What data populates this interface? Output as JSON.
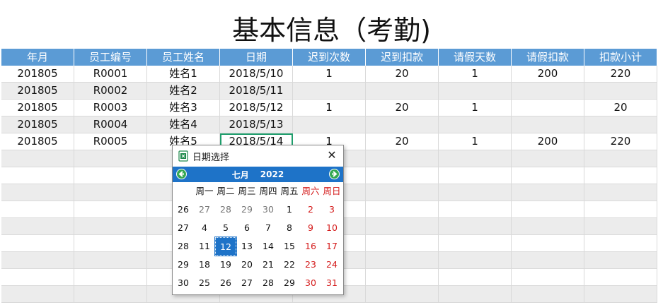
{
  "sheet": {
    "title": "基本信息（考勤)",
    "headers": [
      "年月",
      "员工编号",
      "员工姓名",
      "日期",
      "迟到次数",
      "迟到扣款",
      "请假天数",
      "请假扣款",
      "扣款小计"
    ],
    "rows": [
      [
        "201805",
        "R0001",
        "姓名1",
        "2018/5/10",
        "1",
        "20",
        "1",
        "200",
        "220"
      ],
      [
        "201805",
        "R0002",
        "姓名2",
        "2018/5/11",
        "",
        "",
        "",
        "",
        ""
      ],
      [
        "201805",
        "R0003",
        "姓名3",
        "2018/5/12",
        "1",
        "20",
        "1",
        "",
        "20"
      ],
      [
        "201805",
        "R0004",
        "姓名4",
        "2018/5/13",
        "",
        "",
        "",
        "",
        ""
      ],
      [
        "201805",
        "R0005",
        "姓名5",
        "2018/5/14",
        "1",
        "20",
        "1",
        "200",
        "220"
      ],
      [
        "",
        "",
        "",
        "",
        "",
        "",
        "",
        "",
        ""
      ],
      [
        "",
        "",
        "",
        "",
        "",
        "",
        "",
        "",
        ""
      ],
      [
        "",
        "",
        "",
        "",
        "",
        "",
        "",
        "",
        ""
      ],
      [
        "",
        "",
        "",
        "",
        "",
        "",
        "",
        "",
        ""
      ],
      [
        "",
        "",
        "",
        "",
        "",
        "",
        "",
        "",
        ""
      ],
      [
        "",
        "",
        "",
        "",
        "",
        "",
        "",
        "",
        ""
      ],
      [
        "",
        "",
        "",
        "",
        "",
        "",
        "",
        "",
        ""
      ],
      [
        "",
        "",
        "",
        "",
        "",
        "",
        "",
        "",
        ""
      ],
      [
        "",
        "",
        "",
        "",
        "",
        "",
        "",
        "",
        ""
      ]
    ]
  },
  "picker": {
    "title": "日期选择",
    "close_icon": "close-icon",
    "month": "七月",
    "year": "2022",
    "weekdays": [
      "周一",
      "周二",
      "周三",
      "周四",
      "周五",
      "周六",
      "周日"
    ],
    "weeks": [
      {
        "num": "26",
        "days": [
          "27",
          "28",
          "29",
          "30",
          "1",
          "2",
          "3"
        ]
      },
      {
        "num": "27",
        "days": [
          "4",
          "5",
          "6",
          "7",
          "8",
          "9",
          "10"
        ]
      },
      {
        "num": "28",
        "days": [
          "11",
          "12",
          "13",
          "14",
          "15",
          "16",
          "17"
        ]
      },
      {
        "num": "29",
        "days": [
          "18",
          "19",
          "20",
          "21",
          "22",
          "23",
          "24"
        ]
      },
      {
        "num": "30",
        "days": [
          "25",
          "26",
          "27",
          "28",
          "29",
          "30",
          "31"
        ]
      }
    ],
    "selected_day": "12",
    "colors": {
      "accent": "#1e73c8",
      "weekend": "#d41b1b",
      "header": "#5b9bd5",
      "nav_button": "#35a853"
    }
  }
}
